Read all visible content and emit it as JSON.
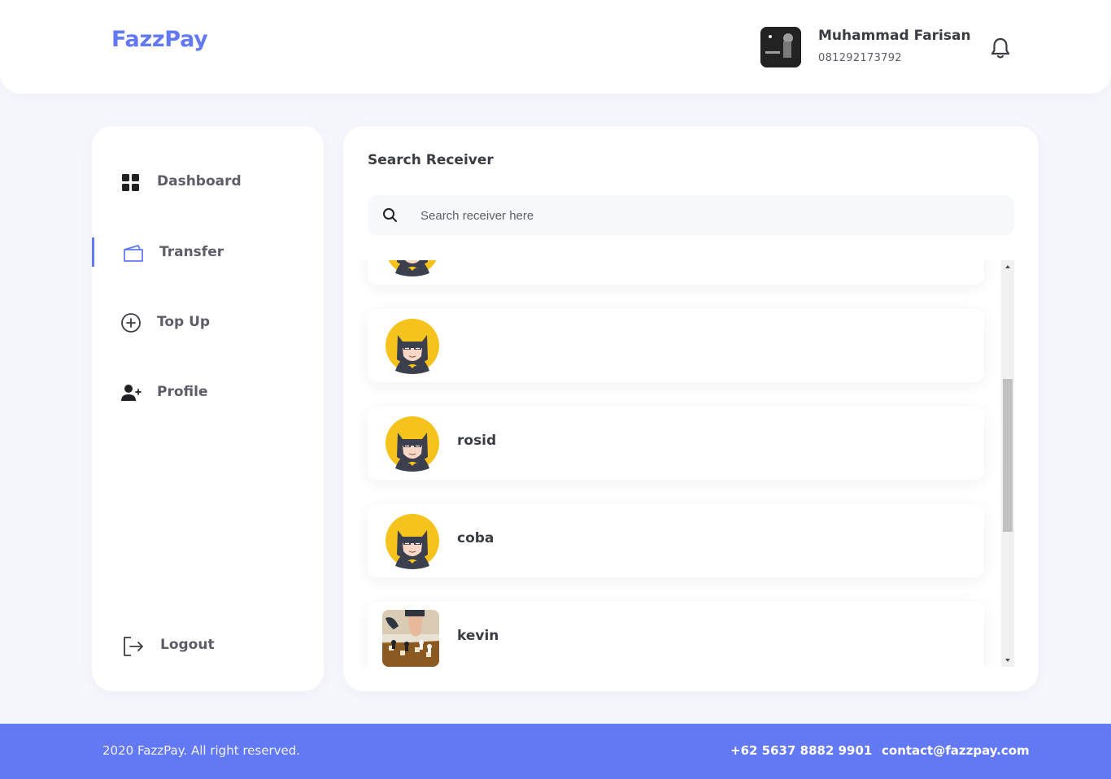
{
  "header": {
    "logo": "FazzPay",
    "user_name": "Muhammad Farisan",
    "user_phone": "081292173792",
    "notification_icon": "bell-icon"
  },
  "sidebar": {
    "items": [
      {
        "label": "Dashboard",
        "icon": "dashboard-grid-icon",
        "active": false
      },
      {
        "label": "Transfer",
        "icon": "wallet-icon",
        "active": true
      },
      {
        "label": "Top Up",
        "icon": "plus-circle-icon",
        "active": false
      },
      {
        "label": "Profile",
        "icon": "user-plus-icon",
        "active": false
      }
    ],
    "logout": {
      "label": "Logout",
      "icon": "logout-icon"
    }
  },
  "main": {
    "title": "Search Receiver",
    "search": {
      "placeholder": "Search receiver here",
      "value": "",
      "icon": "search-icon"
    },
    "receivers": [
      {
        "name": "",
        "avatar": "batman-avatar"
      },
      {
        "name": "",
        "avatar": "batman-avatar"
      },
      {
        "name": "rosid",
        "avatar": "batman-avatar"
      },
      {
        "name": "coba",
        "avatar": "batman-avatar"
      },
      {
        "name": "kevin",
        "avatar": "chess-photo"
      }
    ],
    "list_scroll_position": 0.29
  },
  "footer": {
    "copyright": "2020 FazzPay. All right reserved.",
    "phone": "+62 5637 8882 9901",
    "email": "contact@fazzpay.com"
  },
  "colors": {
    "primary": "#6379f4",
    "background": "#f6f7fc",
    "text": "#3a3d42"
  }
}
